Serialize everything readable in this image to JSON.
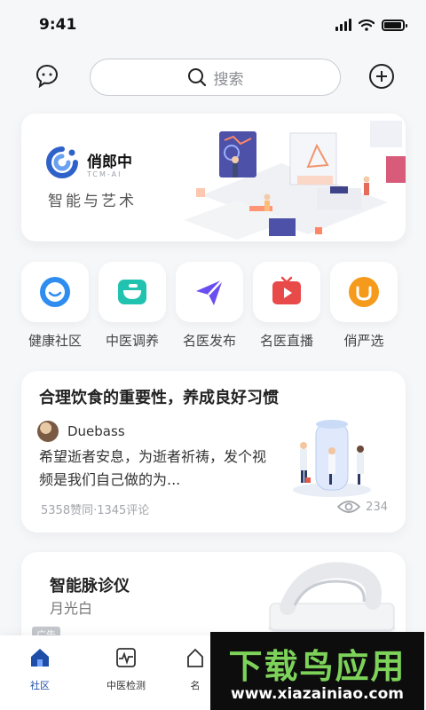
{
  "status_bar": {
    "time": "9:41"
  },
  "header": {
    "chat_icon": "chat-bot-icon",
    "search_placeholder": "搜索",
    "add_icon": "plus-circle-icon"
  },
  "banner": {
    "brand_name": "俏郎中",
    "brand_sub": "TCM-AI",
    "slogan": "智能与艺术"
  },
  "quick_entries": [
    {
      "label": "健康社区",
      "icon": "community-icon",
      "color": "#2f8df0"
    },
    {
      "label": "中医调养",
      "icon": "herbal-bowl-icon",
      "color": "#21c2b0"
    },
    {
      "label": "名医发布",
      "icon": "send-icon",
      "color": "#6b4ef0"
    },
    {
      "label": "名医直播",
      "icon": "tv-icon",
      "color": "#e84a4a"
    },
    {
      "label": "俏严选",
      "icon": "shopping-bag-icon",
      "color": "#f59a1b"
    }
  ],
  "post": {
    "title": "合理饮食的重要性，养成良好习惯",
    "author": "Duebass",
    "body": "希望逝者安息，为逝者祈祷，发个视频是我们自己做的为...",
    "stats": "5358赞同·1345评论",
    "views": "234"
  },
  "ad": {
    "title": "智能脉诊仪",
    "subtitle": "月光白",
    "badge": "广告"
  },
  "tabs": [
    {
      "label": "社区",
      "icon": "home-icon",
      "active": true
    },
    {
      "label": "中医检测",
      "icon": "pulse-monitor-icon",
      "active": false
    },
    {
      "label": "名",
      "icon": "doctor-icon",
      "active": false
    }
  ],
  "watermark": {
    "top": "下载鸟应用",
    "bottom": "www.xiazainiao.com"
  },
  "colors": {
    "accent": "#1f4ea8",
    "background": "#f6f7f9"
  }
}
